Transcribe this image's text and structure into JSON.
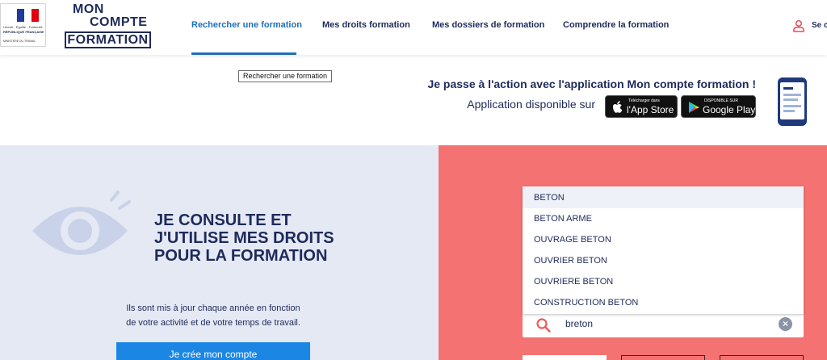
{
  "gov_logo": {
    "motto": "Liberté · Égalité · Fraternité",
    "republic": "RÉPUBLIQUE FRANÇAISE",
    "ministry": "MINISTÈRE DU TRAVAIL"
  },
  "brand": {
    "line1": "MON",
    "line2": "COMPTE",
    "line3": "FORMATION"
  },
  "nav": {
    "items": [
      {
        "label": "Rechercher une formation"
      },
      {
        "label": "Mes droits formation"
      },
      {
        "label": "Mes dossiers de formation"
      },
      {
        "label": "Comprendre la formation"
      }
    ],
    "login_label": "Se c"
  },
  "tooltip": {
    "text": "Rechercher une formation"
  },
  "promo": {
    "title": "Je passe à l'action avec l'application Mon compte formation !",
    "subtitle": "Application disponible sur",
    "app_store": {
      "small": "Télécharger dans",
      "big": "l'App Store"
    },
    "google_play": {
      "small": "DISPONIBLE SUR",
      "big": "Google Play"
    }
  },
  "left": {
    "heading_lines": [
      "JE CONSULTE ET",
      "J'UTILISE MES DROITS",
      "POUR LA FORMATION"
    ],
    "desc_lines": [
      "Ils sont mis à jour chaque année en fonction",
      "de votre activité et de votre temps de travail."
    ],
    "cta_label": "Je crée mon compte"
  },
  "search": {
    "value": "breton",
    "suggestions": [
      "BETON",
      "BETON ARME",
      "OUVRAGE BETON",
      "OUVRIER BETON",
      "OUVRIERE BETON",
      "CONSTRUCTION BETON"
    ]
  },
  "colors": {
    "navy": "#1e2a5a",
    "active_blue": "#1f6fb8",
    "cta_blue": "#1c86e4",
    "left_bg": "#e5e9f4",
    "right_bg": "#f47272"
  }
}
